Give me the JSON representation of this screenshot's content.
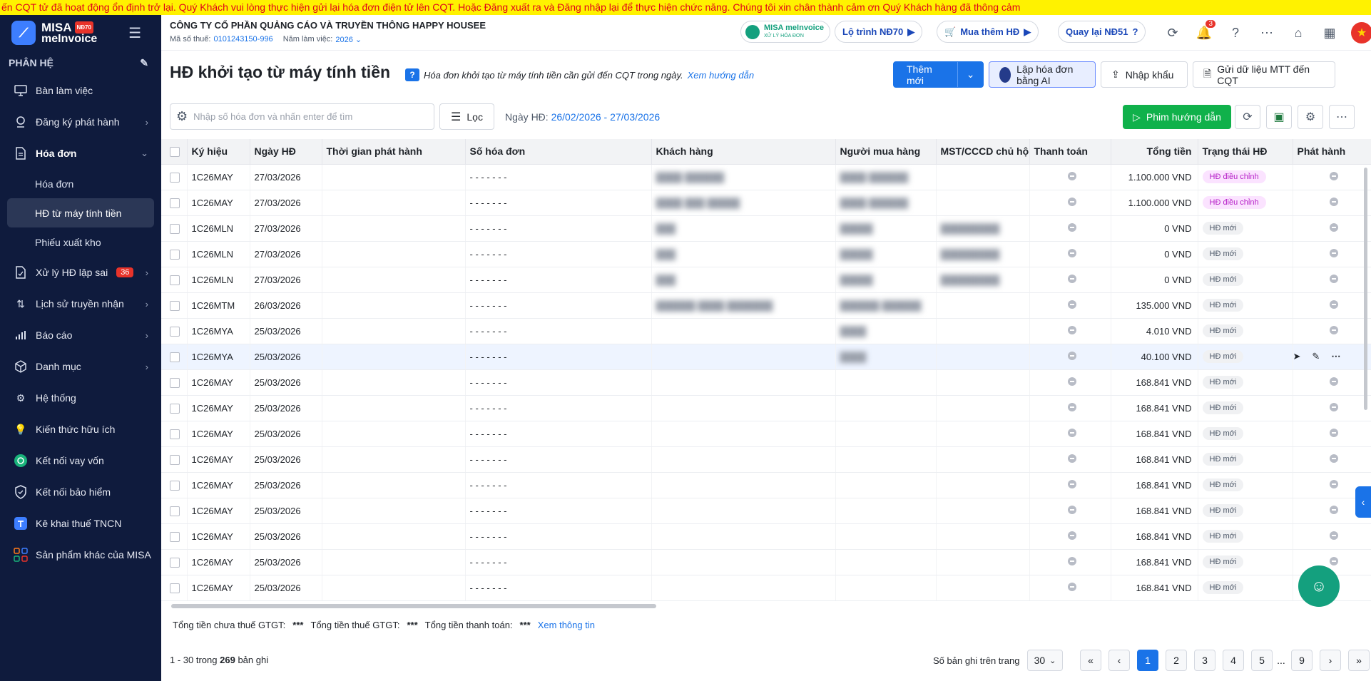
{
  "banner": {
    "text": "ến CQT tử đã hoạt động ổn định trở lại. Quý Khách vui lòng thực hiện gửi lại hóa đơn điện tử lên CQT. Hoặc Đăng xuất ra và Đăng nhập lại để thực hiện chức năng. Chúng tôi xin chân thành cảm ơn Quý Khách hàng đã thông cảm"
  },
  "logo": {
    "brand": "MISA",
    "badge": "NĐ70",
    "product": "meInvoice"
  },
  "sidebar": {
    "section_title": "PHÂN HỆ",
    "items": [
      {
        "label": "Bàn làm việc",
        "icon": "monitor-icon"
      },
      {
        "label": "Đăng ký phát hành",
        "icon": "stamp-icon"
      },
      {
        "label": "Hóa đơn",
        "icon": "document-icon"
      },
      {
        "label": "Xử lý HĐ lập sai",
        "icon": "edit-document-icon",
        "badge": "36"
      },
      {
        "label": "Lịch sử truyền nhận",
        "icon": "transfer-icon"
      },
      {
        "label": "Báo cáo",
        "icon": "bar-chart-icon"
      },
      {
        "label": "Danh mục",
        "icon": "box-icon"
      },
      {
        "label": "Hệ thống",
        "icon": "gear-icon"
      },
      {
        "label": "Kiến thức hữu ích",
        "icon": "lightbulb-icon"
      },
      {
        "label": "Kết nối vay vốn",
        "icon": "loan-icon"
      },
      {
        "label": "Kết nối bảo hiểm",
        "icon": "shield-icon"
      },
      {
        "label": "Kê khai thuế TNCN",
        "icon": "tax-icon"
      },
      {
        "label": "Sản phẩm khác của MISA",
        "icon": "apps-icon"
      }
    ],
    "sub_items": [
      {
        "label": "Hóa đơn"
      },
      {
        "label": "HĐ từ máy tính tiền"
      },
      {
        "label": "Phiếu xuất kho"
      }
    ]
  },
  "topbar": {
    "company_name": "CÔNG TY CỔ PHẦN QUẢNG CÁO VÀ TRUYỀN THÔNG HAPPY HOUSEE",
    "tax_label": "Mã số thuế:",
    "tax_code": "0101243150-996",
    "year_label": "Năm làm việc:",
    "year": "2026",
    "misa_pill_main": "MISA meInvoice",
    "misa_pill_sub": "XỬ LÝ HÓA ĐƠN",
    "roadmap": "Lộ trình NĐ70",
    "buy_more": "Mua thêm HĐ",
    "back_nd51": "Quay lại NĐ51",
    "notif_count": "3"
  },
  "header": {
    "title": "HĐ khởi tạo từ máy tính tiền",
    "hint": "Hóa đơn khởi tạo từ máy tính tiền cần gửi đến CQT trong ngày.",
    "hint_link": "Xem hướng dẫn",
    "add_new": "Thêm mới",
    "ai_invoice": "Lập hóa đơn bằng AI",
    "import": "Nhập khẩu",
    "send_mtt": "Gửi dữ liệu MTT đến CQT"
  },
  "toolbar": {
    "search_placeholder": "Nhập số hóa đơn và nhấn enter để tìm",
    "filter": "Lọc",
    "date_label": "Ngày HĐ:",
    "date_range": "26/02/2026 - 27/03/2026",
    "guide": "Phim hướng dẫn"
  },
  "table": {
    "columns": [
      "Ký hiệu",
      "Ngày HĐ",
      "Thời gian phát hành",
      "Số hóa đơn",
      "Khách hàng",
      "Người mua hàng",
      "MST/CCCD chủ hộ",
      "Thanh toán",
      "Tổng tiền",
      "Trạng thái HĐ",
      "Phát hành"
    ],
    "rows": [
      {
        "kh": "1C26MAY",
        "date": "27/03/2026",
        "so": "- - - - - - -",
        "total": "1.100.000 VND",
        "status": "HĐ điều chỉnh",
        "cust": "████ ██████",
        "buyer": "████ ██████",
        "mst": ""
      },
      {
        "kh": "1C26MAY",
        "date": "27/03/2026",
        "so": "- - - - - - -",
        "total": "1.100.000 VND",
        "status": "HĐ điều chỉnh",
        "cust": "████ ███ █████",
        "buyer": "████ ██████",
        "mst": ""
      },
      {
        "kh": "1C26MLN",
        "date": "27/03/2026",
        "so": "- - - - - - -",
        "total": "0 VND",
        "status": "HĐ mới",
        "cust": "███",
        "buyer": "█████",
        "mst": "█████████"
      },
      {
        "kh": "1C26MLN",
        "date": "27/03/2026",
        "so": "- - - - - - -",
        "total": "0 VND",
        "status": "HĐ mới",
        "cust": "███",
        "buyer": "█████",
        "mst": "█████████"
      },
      {
        "kh": "1C26MLN",
        "date": "27/03/2026",
        "so": "- - - - - - -",
        "total": "0 VND",
        "status": "HĐ mới",
        "cust": "███",
        "buyer": "█████",
        "mst": "█████████"
      },
      {
        "kh": "1C26MTM",
        "date": "26/03/2026",
        "so": "- - - - - - -",
        "total": "135.000 VND",
        "status": "HĐ mới",
        "cust": "██████ ████ ███████",
        "buyer": "██████ ██████",
        "mst": ""
      },
      {
        "kh": "1C26MYA",
        "date": "25/03/2026",
        "so": "- - - - - - -",
        "total": "4.010 VND",
        "status": "HĐ mới",
        "cust": "",
        "buyer": "████",
        "mst": ""
      },
      {
        "kh": "1C26MYA",
        "date": "25/03/2026",
        "so": "- - - - - - -",
        "total": "40.100 VND",
        "status": "HĐ mới",
        "cust": "",
        "buyer": "████",
        "mst": "",
        "hover": true
      },
      {
        "kh": "1C26MAY",
        "date": "25/03/2026",
        "so": "- - - - - - -",
        "total": "168.841 VND",
        "status": "HĐ mới",
        "cust": "",
        "buyer": "",
        "mst": ""
      },
      {
        "kh": "1C26MAY",
        "date": "25/03/2026",
        "so": "- - - - - - -",
        "total": "168.841 VND",
        "status": "HĐ mới",
        "cust": "",
        "buyer": "",
        "mst": ""
      },
      {
        "kh": "1C26MAY",
        "date": "25/03/2026",
        "so": "- - - - - - -",
        "total": "168.841 VND",
        "status": "HĐ mới",
        "cust": "",
        "buyer": "",
        "mst": ""
      },
      {
        "kh": "1C26MAY",
        "date": "25/03/2026",
        "so": "- - - - - - -",
        "total": "168.841 VND",
        "status": "HĐ mới",
        "cust": "",
        "buyer": "",
        "mst": ""
      },
      {
        "kh": "1C26MAY",
        "date": "25/03/2026",
        "so": "- - - - - - -",
        "total": "168.841 VND",
        "status": "HĐ mới",
        "cust": "",
        "buyer": "",
        "mst": ""
      },
      {
        "kh": "1C26MAY",
        "date": "25/03/2026",
        "so": "- - - - - - -",
        "total": "168.841 VND",
        "status": "HĐ mới",
        "cust": "",
        "buyer": "",
        "mst": ""
      },
      {
        "kh": "1C26MAY",
        "date": "25/03/2026",
        "so": "- - - - - - -",
        "total": "168.841 VND",
        "status": "HĐ mới",
        "cust": "",
        "buyer": "",
        "mst": ""
      },
      {
        "kh": "1C26MAY",
        "date": "25/03/2026",
        "so": "- - - - - - -",
        "total": "168.841 VND",
        "status": "HĐ mới",
        "cust": "",
        "buyer": "",
        "mst": ""
      },
      {
        "kh": "1C26MAY",
        "date": "25/03/2026",
        "so": "- - - - - - -",
        "total": "168.841 VND",
        "status": "HĐ mới",
        "cust": "",
        "buyer": "",
        "mst": ""
      }
    ]
  },
  "colors": {
    "status_adjust_bg": "#fbe3ff",
    "status_adjust_fg": "#b620c8",
    "status_new_bg": "#f0f1f3",
    "status_new_fg": "#4e5969"
  },
  "totals": {
    "pre_tax_label": "Tổng tiền chưa thuế GTGT:",
    "pre_tax_value": "***",
    "tax_label": "Tổng tiền thuế GTGT:",
    "tax_value": "***",
    "payment_label": "Tổng tiền thanh toán:",
    "payment_value": "***",
    "view_link": "Xem thông tin"
  },
  "pager": {
    "range_prefix": "1 - 30 trong",
    "total_records": "269",
    "range_suffix": "bản ghi",
    "per_page_label": "Số bản ghi trên trang",
    "per_page": "30",
    "pages": [
      "1",
      "2",
      "3",
      "4",
      "5",
      "...",
      "9"
    ],
    "current_page": "1"
  }
}
